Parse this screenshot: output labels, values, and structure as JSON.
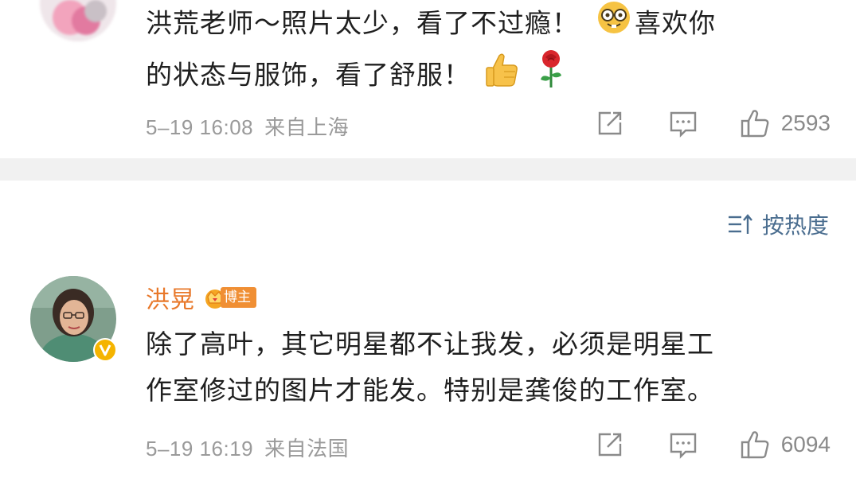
{
  "comments": [
    {
      "lines": [
        [
          "洪荒老师～照片太少，看了不过瘾！",
          "喜欢你"
        ],
        [
          "的状态与服饰，看了舒服！"
        ]
      ],
      "emojis": [
        "nerd-face-emoji",
        "thumbs-up-emoji",
        "rose-emoji"
      ],
      "date": "5–19 16:08",
      "location": "来自上海",
      "likes": "2593"
    },
    {
      "author": "洪晃",
      "badge": "博主",
      "lines": [
        "除了高叶，其它明星都不让我发，必须是明星工",
        "作室修过的图片才能发。特别是龚俊的工作室。"
      ],
      "date": "5–19 16:19",
      "location": "来自法国",
      "likes": "6094"
    }
  ],
  "sort": {
    "label": "按热度",
    "icon": "sort-icon"
  },
  "icons": {
    "share": "share-icon",
    "comment": "comment-icon",
    "like": "thumbs-up-icon",
    "verified": "verified-badge-icon",
    "crown": "crown-icon"
  },
  "colors": {
    "author": "#e8782a",
    "badge": "#f08f34",
    "sort_link": "#4a6d8f",
    "meta_text": "#9a9a9a",
    "divider": "#f1f1f1",
    "verified": "#f5b400"
  }
}
